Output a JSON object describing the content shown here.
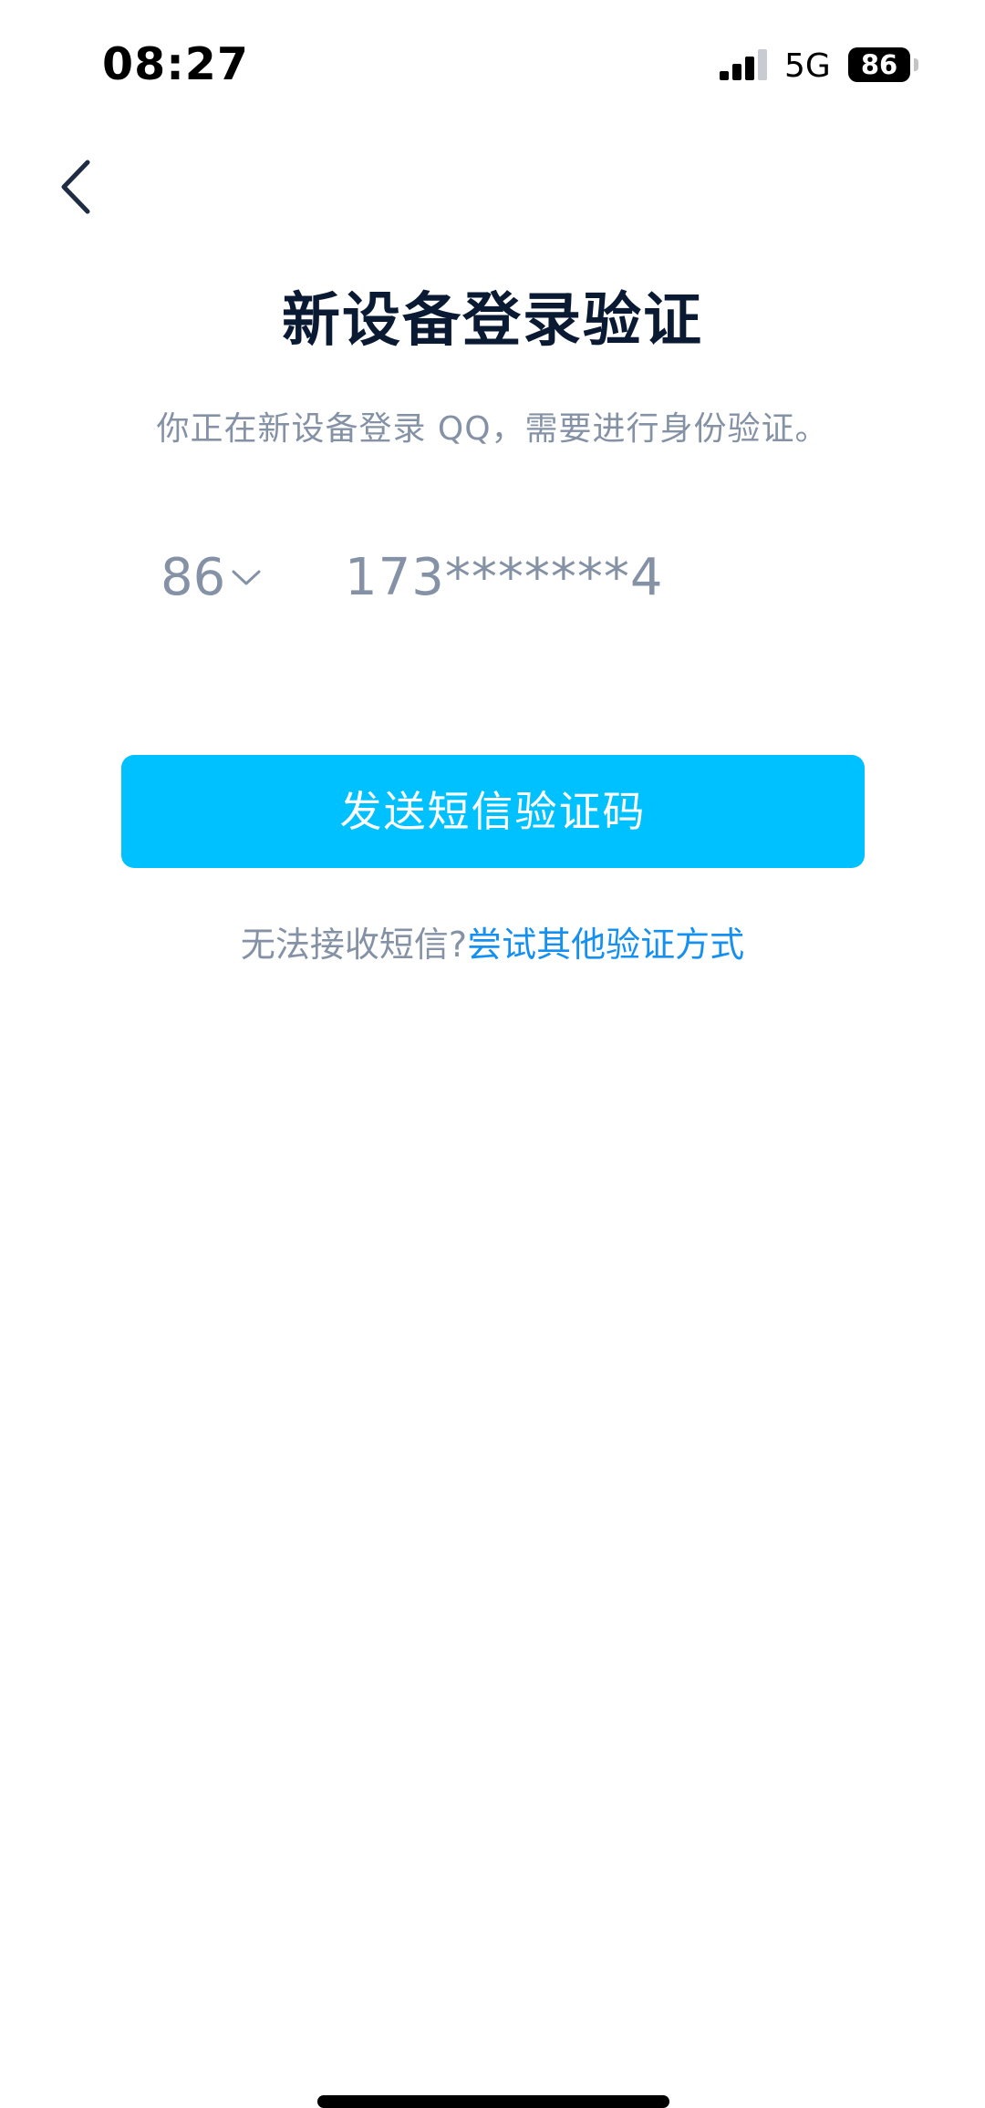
{
  "status_bar": {
    "time": "08:27",
    "network": "5G",
    "battery": "86",
    "signal_icon": "signal-bars-icon"
  },
  "nav": {
    "back_icon": "chevron-left-icon"
  },
  "title": "新设备登录验证",
  "subtitle": "你正在新设备登录 QQ，需要进行身份验证。",
  "phone": {
    "country_code": "86",
    "number": "173*******4"
  },
  "send_button_label": "发送短信验证码",
  "alternative": {
    "hint": "无法接收短信?",
    "link": "尝试其他验证方式"
  },
  "colors": {
    "accent": "#00c1ff",
    "link": "#1590f0",
    "title": "#0b1a33",
    "muted": "#8592a6"
  }
}
